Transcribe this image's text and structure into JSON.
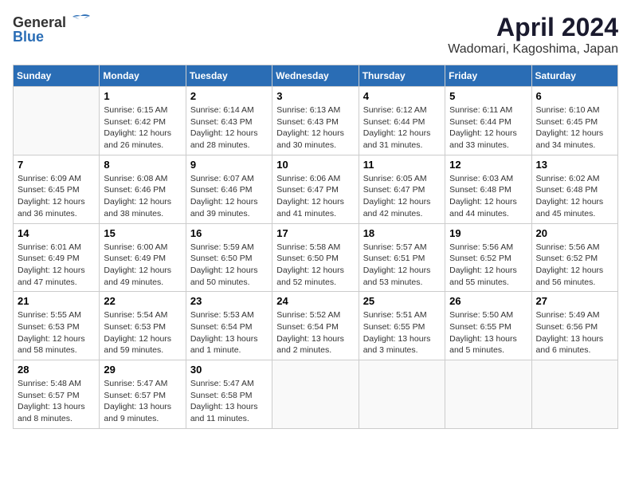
{
  "header": {
    "logo_general": "General",
    "logo_blue": "Blue",
    "title": "April 2024",
    "location": "Wadomari, Kagoshima, Japan"
  },
  "days_of_week": [
    "Sunday",
    "Monday",
    "Tuesday",
    "Wednesday",
    "Thursday",
    "Friday",
    "Saturday"
  ],
  "weeks": [
    [
      {
        "day": "",
        "info": ""
      },
      {
        "day": "1",
        "info": "Sunrise: 6:15 AM\nSunset: 6:42 PM\nDaylight: 12 hours\nand 26 minutes."
      },
      {
        "day": "2",
        "info": "Sunrise: 6:14 AM\nSunset: 6:43 PM\nDaylight: 12 hours\nand 28 minutes."
      },
      {
        "day": "3",
        "info": "Sunrise: 6:13 AM\nSunset: 6:43 PM\nDaylight: 12 hours\nand 30 minutes."
      },
      {
        "day": "4",
        "info": "Sunrise: 6:12 AM\nSunset: 6:44 PM\nDaylight: 12 hours\nand 31 minutes."
      },
      {
        "day": "5",
        "info": "Sunrise: 6:11 AM\nSunset: 6:44 PM\nDaylight: 12 hours\nand 33 minutes."
      },
      {
        "day": "6",
        "info": "Sunrise: 6:10 AM\nSunset: 6:45 PM\nDaylight: 12 hours\nand 34 minutes."
      }
    ],
    [
      {
        "day": "7",
        "info": "Sunrise: 6:09 AM\nSunset: 6:45 PM\nDaylight: 12 hours\nand 36 minutes."
      },
      {
        "day": "8",
        "info": "Sunrise: 6:08 AM\nSunset: 6:46 PM\nDaylight: 12 hours\nand 38 minutes."
      },
      {
        "day": "9",
        "info": "Sunrise: 6:07 AM\nSunset: 6:46 PM\nDaylight: 12 hours\nand 39 minutes."
      },
      {
        "day": "10",
        "info": "Sunrise: 6:06 AM\nSunset: 6:47 PM\nDaylight: 12 hours\nand 41 minutes."
      },
      {
        "day": "11",
        "info": "Sunrise: 6:05 AM\nSunset: 6:47 PM\nDaylight: 12 hours\nand 42 minutes."
      },
      {
        "day": "12",
        "info": "Sunrise: 6:03 AM\nSunset: 6:48 PM\nDaylight: 12 hours\nand 44 minutes."
      },
      {
        "day": "13",
        "info": "Sunrise: 6:02 AM\nSunset: 6:48 PM\nDaylight: 12 hours\nand 45 minutes."
      }
    ],
    [
      {
        "day": "14",
        "info": "Sunrise: 6:01 AM\nSunset: 6:49 PM\nDaylight: 12 hours\nand 47 minutes."
      },
      {
        "day": "15",
        "info": "Sunrise: 6:00 AM\nSunset: 6:49 PM\nDaylight: 12 hours\nand 49 minutes."
      },
      {
        "day": "16",
        "info": "Sunrise: 5:59 AM\nSunset: 6:50 PM\nDaylight: 12 hours\nand 50 minutes."
      },
      {
        "day": "17",
        "info": "Sunrise: 5:58 AM\nSunset: 6:50 PM\nDaylight: 12 hours\nand 52 minutes."
      },
      {
        "day": "18",
        "info": "Sunrise: 5:57 AM\nSunset: 6:51 PM\nDaylight: 12 hours\nand 53 minutes."
      },
      {
        "day": "19",
        "info": "Sunrise: 5:56 AM\nSunset: 6:52 PM\nDaylight: 12 hours\nand 55 minutes."
      },
      {
        "day": "20",
        "info": "Sunrise: 5:56 AM\nSunset: 6:52 PM\nDaylight: 12 hours\nand 56 minutes."
      }
    ],
    [
      {
        "day": "21",
        "info": "Sunrise: 5:55 AM\nSunset: 6:53 PM\nDaylight: 12 hours\nand 58 minutes."
      },
      {
        "day": "22",
        "info": "Sunrise: 5:54 AM\nSunset: 6:53 PM\nDaylight: 12 hours\nand 59 minutes."
      },
      {
        "day": "23",
        "info": "Sunrise: 5:53 AM\nSunset: 6:54 PM\nDaylight: 13 hours\nand 1 minute."
      },
      {
        "day": "24",
        "info": "Sunrise: 5:52 AM\nSunset: 6:54 PM\nDaylight: 13 hours\nand 2 minutes."
      },
      {
        "day": "25",
        "info": "Sunrise: 5:51 AM\nSunset: 6:55 PM\nDaylight: 13 hours\nand 3 minutes."
      },
      {
        "day": "26",
        "info": "Sunrise: 5:50 AM\nSunset: 6:55 PM\nDaylight: 13 hours\nand 5 minutes."
      },
      {
        "day": "27",
        "info": "Sunrise: 5:49 AM\nSunset: 6:56 PM\nDaylight: 13 hours\nand 6 minutes."
      }
    ],
    [
      {
        "day": "28",
        "info": "Sunrise: 5:48 AM\nSunset: 6:57 PM\nDaylight: 13 hours\nand 8 minutes."
      },
      {
        "day": "29",
        "info": "Sunrise: 5:47 AM\nSunset: 6:57 PM\nDaylight: 13 hours\nand 9 minutes."
      },
      {
        "day": "30",
        "info": "Sunrise: 5:47 AM\nSunset: 6:58 PM\nDaylight: 13 hours\nand 11 minutes."
      },
      {
        "day": "",
        "info": ""
      },
      {
        "day": "",
        "info": ""
      },
      {
        "day": "",
        "info": ""
      },
      {
        "day": "",
        "info": ""
      }
    ]
  ]
}
